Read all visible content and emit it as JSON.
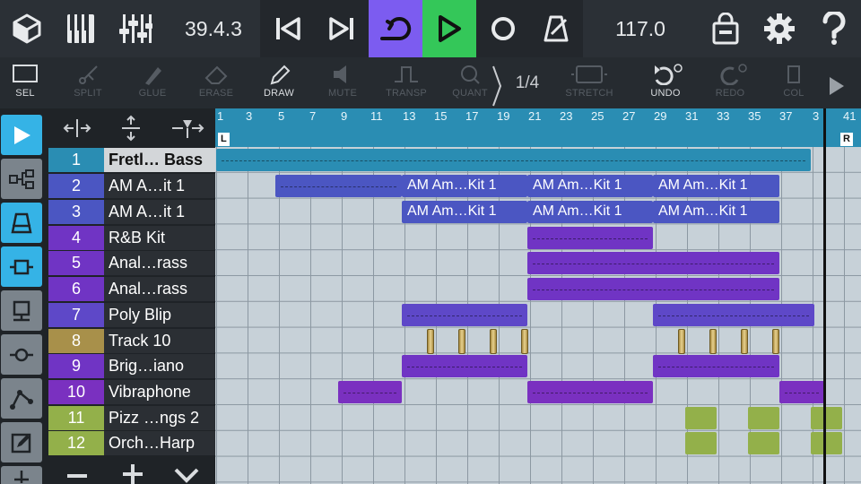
{
  "transport": {
    "position": "39.4.3",
    "tempo": "117.0",
    "icons": [
      "cube-icon",
      "keyboard-icon",
      "mixer-icon",
      "skip-back-icon",
      "skip-forward-icon",
      "loop-icon",
      "play-icon",
      "record-icon",
      "metronome-icon",
      "shop-icon",
      "gear-icon",
      "help-icon"
    ]
  },
  "toolbar": {
    "sel": "SEL",
    "split": "SPLIT",
    "glue": "GLUE",
    "erase": "ERASE",
    "draw": "DRAW",
    "mute": "MUTE",
    "transp": "TRANSP",
    "quant": "QUANT",
    "quant_value": "1/4",
    "stretch": "STRETCH",
    "undo": "UNDO",
    "redo": "REDO",
    "col": "COL"
  },
  "ruler": {
    "bars": [
      "1",
      "3",
      "5",
      "7",
      "9",
      "11",
      "13",
      "15",
      "17",
      "19",
      "21",
      "23",
      "25",
      "27",
      "29",
      "31",
      "33",
      "35",
      "37",
      "3",
      "41"
    ],
    "left_marker": "L",
    "right_marker": "R"
  },
  "tracks": [
    {
      "num": "1",
      "name": "Fretl… Bass",
      "color": "#2a8db3",
      "selected": true
    },
    {
      "num": "2",
      "name": "AM A…it 1",
      "color": "#4b56c2"
    },
    {
      "num": "3",
      "name": "AM A…it 1",
      "color": "#4b56c2"
    },
    {
      "num": "4",
      "name": "R&B Kit",
      "color": "#7034c4"
    },
    {
      "num": "5",
      "name": "Anal…rass",
      "color": "#7034c4"
    },
    {
      "num": "6",
      "name": "Anal…rass",
      "color": "#7034c4"
    },
    {
      "num": "7",
      "name": "Poly Blip",
      "color": "#5e48c8"
    },
    {
      "num": "8",
      "name": "Track 10",
      "color": "#a8904a"
    },
    {
      "num": "9",
      "name": "Brig…iano",
      "color": "#7034c4"
    },
    {
      "num": "10",
      "name": "Vibraphone",
      "color": "#7a30c0"
    },
    {
      "num": "11",
      "name": "Pizz …ngs 2",
      "color": "#93b04a"
    },
    {
      "num": "12",
      "name": "Orch…Harp",
      "color": "#93b04a"
    }
  ],
  "clip_label": "AM Am…Kit 1",
  "colors": {
    "accent_blue": "#35b3e6",
    "loop_purple": "#7c5cf0",
    "play_green": "#34c759"
  }
}
